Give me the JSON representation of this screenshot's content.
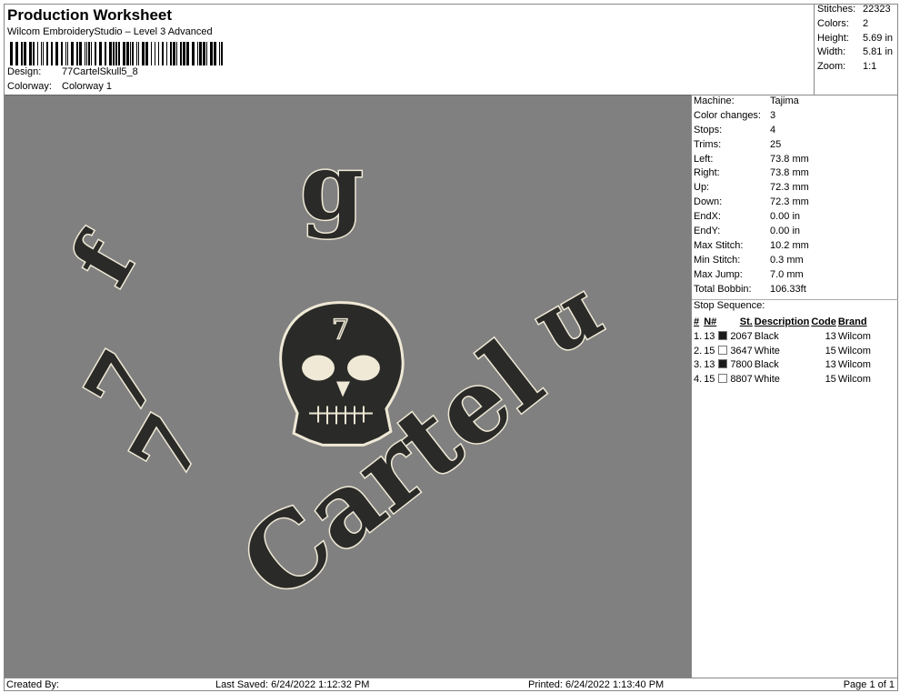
{
  "header": {
    "title": "Production Worksheet",
    "subtitle": "Wilcom EmbroideryStudio – Level 3 Advanced",
    "design_label": "Design:",
    "design_value": "77CartelSkull5_8",
    "colorway_label": "Colorway:",
    "colorway_value": "Colorway 1"
  },
  "stats": [
    {
      "k": "Stitches:",
      "v": "22323"
    },
    {
      "k": "Colors:",
      "v": "2"
    },
    {
      "k": "Height:",
      "v": "5.69 in"
    },
    {
      "k": "Width:",
      "v": "5.81 in"
    },
    {
      "k": "Zoom:",
      "v": "1:1"
    }
  ],
  "machine": [
    {
      "k": "Machine:",
      "v": "Tajima"
    },
    {
      "k": "Color changes:",
      "v": "3"
    },
    {
      "k": "Stops:",
      "v": "4"
    },
    {
      "k": "Trims:",
      "v": "25"
    },
    {
      "k": "Left:",
      "v": "73.8 mm"
    },
    {
      "k": "Right:",
      "v": "73.8 mm"
    },
    {
      "k": "Up:",
      "v": "72.3 mm"
    },
    {
      "k": "Down:",
      "v": "72.3 mm"
    },
    {
      "k": "EndX:",
      "v": "0.00 in"
    },
    {
      "k": "EndY:",
      "v": "0.00 in"
    },
    {
      "k": "Max Stitch:",
      "v": "10.2 mm"
    },
    {
      "k": "Min Stitch:",
      "v": "0.3 mm"
    },
    {
      "k": "Max Jump:",
      "v": "7.0 mm"
    },
    {
      "k": "Total Bobbin:",
      "v": "106.33ft"
    }
  ],
  "stop_sequence": {
    "label": "Stop Sequence:",
    "headers": [
      "#",
      "N#",
      "St.",
      "Description",
      "Code",
      "Brand"
    ],
    "rows": [
      {
        "n": "1.",
        "nn": "13",
        "color": "#1a1a1a",
        "st": "2067",
        "desc": "Black",
        "code": "13",
        "brand": "Wilcom"
      },
      {
        "n": "2.",
        "nn": "15",
        "color": "#ffffff",
        "st": "3647",
        "desc": "White",
        "code": "15",
        "brand": "Wilcom"
      },
      {
        "n": "3.",
        "nn": "13",
        "color": "#1a1a1a",
        "st": "7800",
        "desc": "Black",
        "code": "13",
        "brand": "Wilcom"
      },
      {
        "n": "4.",
        "nn": "15",
        "color": "#ffffff",
        "st": "8807",
        "desc": "White",
        "code": "15",
        "brand": "Wilcom"
      }
    ]
  },
  "artwork": {
    "background": "#808080",
    "fill": "#2a2a28",
    "outline": "#efe9d6",
    "letters": [
      "7",
      "7",
      "f",
      "g",
      "n",
      "Cartel",
      "7"
    ]
  },
  "footer": {
    "created": "Created By:",
    "saved": "Last Saved: 6/24/2022 1:12:32 PM",
    "printed": "Printed: 6/24/2022 1:13:40 PM",
    "page": "Page 1 of 1"
  }
}
